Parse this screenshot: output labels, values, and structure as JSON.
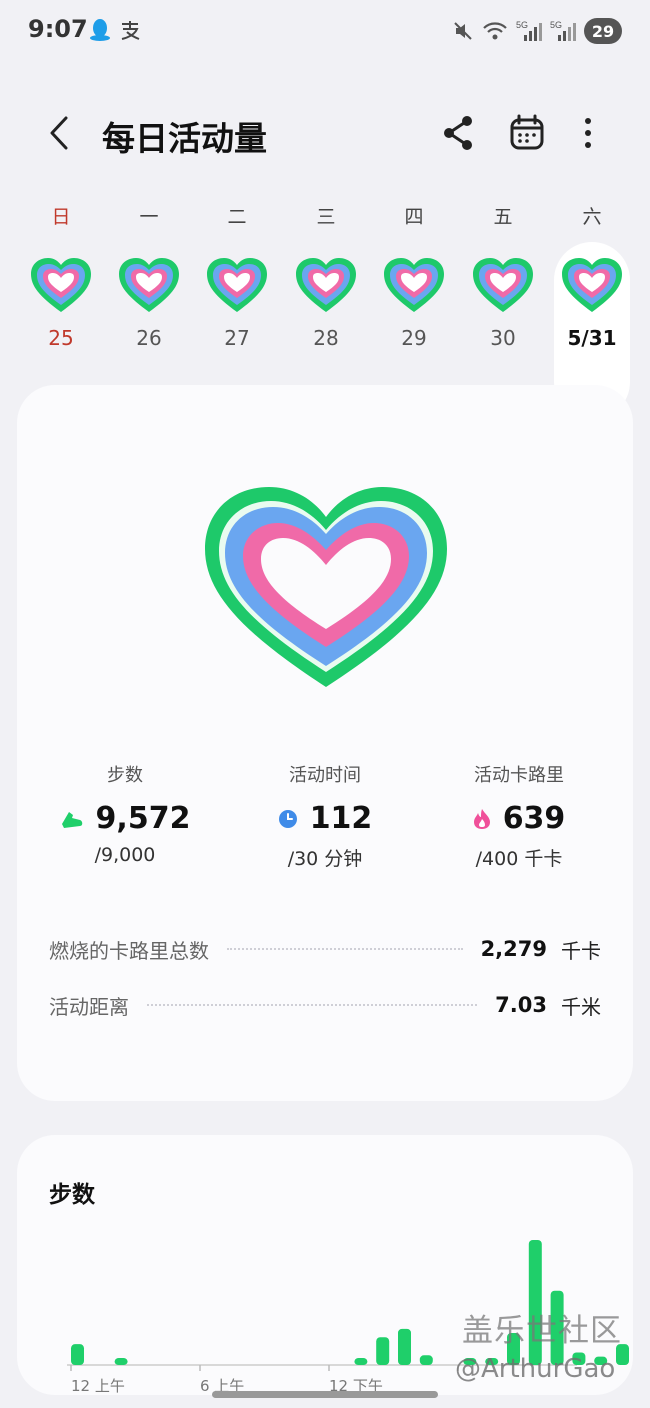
{
  "status_bar": {
    "time": "9:07",
    "battery": "29",
    "signal_labels": [
      "5G",
      "5G"
    ]
  },
  "app_bar": {
    "title": "每日活动量"
  },
  "week": [
    {
      "weekday": "日",
      "date": "25",
      "sunday": true,
      "selected": false
    },
    {
      "weekday": "一",
      "date": "26",
      "sunday": false,
      "selected": false
    },
    {
      "weekday": "二",
      "date": "27",
      "sunday": false,
      "selected": false
    },
    {
      "weekday": "三",
      "date": "28",
      "sunday": false,
      "selected": false
    },
    {
      "weekday": "四",
      "date": "29",
      "sunday": false,
      "selected": false
    },
    {
      "weekday": "五",
      "date": "30",
      "sunday": false,
      "selected": false
    },
    {
      "weekday": "六",
      "date": "5/31",
      "sunday": false,
      "selected": true
    }
  ],
  "metrics": {
    "steps": {
      "label": "步数",
      "value": "9,572",
      "goal": "/9,000",
      "color": "#1fcf6a",
      "icon": "shoe-icon"
    },
    "active_time": {
      "label": "活动时间",
      "value": "112",
      "goal": "/30 分钟",
      "color": "#3f8be8",
      "icon": "clock-icon"
    },
    "calories": {
      "label": "活动卡路里",
      "value": "639",
      "goal": "/400 千卡",
      "color": "#f0509a",
      "icon": "flame-icon"
    }
  },
  "stats": [
    {
      "label": "燃烧的卡路里总数",
      "value": "2,279",
      "unit": "千卡"
    },
    {
      "label": "活动距离",
      "value": "7.03",
      "unit": "千米"
    }
  ],
  "steps_chart": {
    "title": "步数",
    "tick_labels": [
      "12 上午",
      "6 上午",
      "12 下午"
    ]
  },
  "chart_data": {
    "type": "bar",
    "title": "步数",
    "x_ticks": [
      "12 上午",
      "6 上午",
      "12 下午"
    ],
    "values": [
      30,
      0,
      10,
      0,
      0,
      0,
      0,
      0,
      0,
      0,
      0,
      0,
      0,
      10,
      40,
      52,
      14,
      0,
      10,
      10,
      46,
      180,
      107,
      18,
      12,
      30,
      10,
      20,
      10
    ],
    "color": "#1fcf6a"
  },
  "watermark": {
    "line1": "盖乐世社区",
    "line2": "@ArthurGao"
  }
}
